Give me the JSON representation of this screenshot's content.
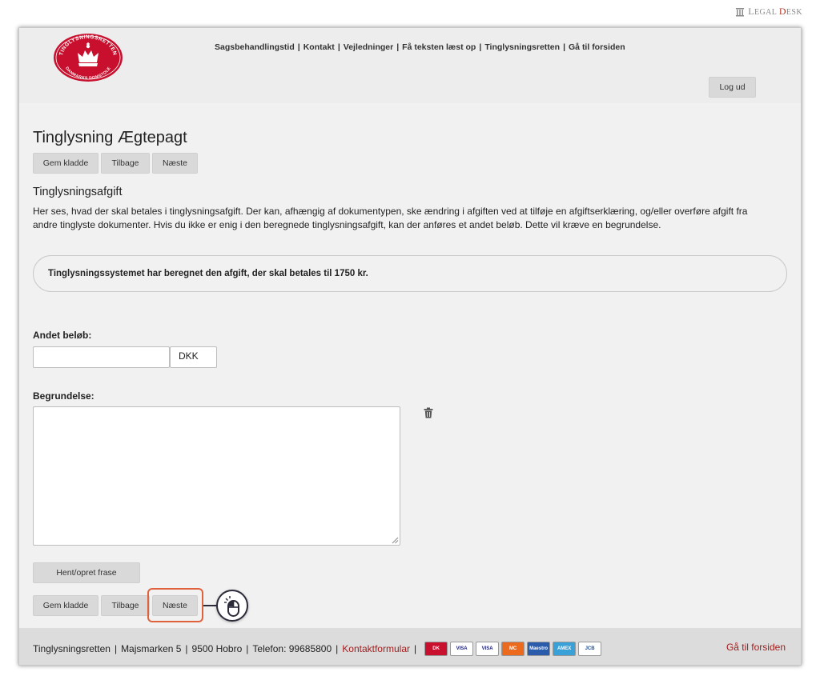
{
  "brand": {
    "watermark": "Legal Desk"
  },
  "header": {
    "logo_top_text": "TINGLYSNINGSRETTEN",
    "logo_bottom_text": "DANMARKS DOMSTOLE",
    "nav": [
      "Sagsbehandlingstid",
      "Kontakt",
      "Vejledninger",
      "Få teksten læst op",
      "Tinglysningsretten",
      "Gå til forsiden"
    ],
    "logout_label": "Log ud"
  },
  "page": {
    "title": "Tinglysning Ægtepagt",
    "buttons": {
      "save_draft": "Gem kladde",
      "back": "Tilbage",
      "next": "Næste"
    },
    "section_title": "Tinglysningsafgift",
    "description": "Her ses, hvad der skal betales i tinglysningsafgift. Der kan, afhængig af dokumentypen, ske ændring i afgiften ved at tilføje en afgiftserklæring, og/eller overføre afgift fra andre tinglyste dokumenter. Hvis du ikke er enig i den beregnede tinglysningsafgift, kan der anføres et andet beløb. Dette vil kræve en begrundelse.",
    "info_message": "Tinglysningssystemet har beregnet den afgift, der skal betales til 1750 kr.",
    "amount_label": "Andet beløb:",
    "amount_value": "",
    "currency": "DKK",
    "reason_label": "Begrundelse:",
    "reason_value": "",
    "phrase_button": "Hent/opret frase"
  },
  "footer": {
    "org": "Tinglysningsretten",
    "address": "Majsmarken 5",
    "city": "9500 Hobro",
    "phone": "Telefon: 99685800",
    "contact_link": "Kontaktformular",
    "cards": [
      "DK",
      "VISA",
      "VISA",
      "MC",
      "Maestro",
      "AMEX",
      "JCB"
    ],
    "home_link": "Gå til forsiden"
  },
  "colors": {
    "accent": "#a31d1d",
    "highlight": "#e0623d",
    "logo_red": "#c8102e"
  }
}
